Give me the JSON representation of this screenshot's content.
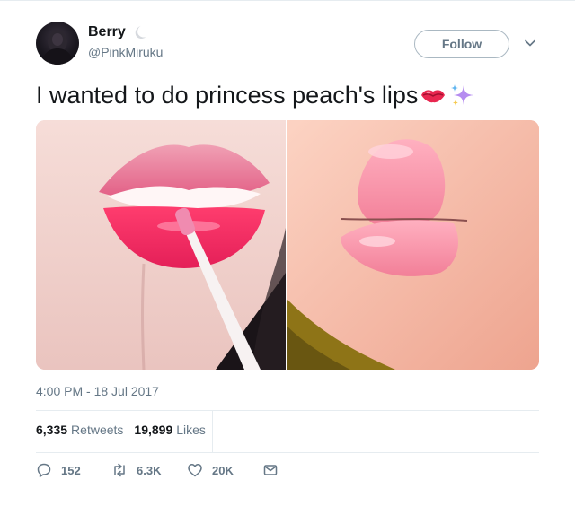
{
  "user": {
    "display_name": "Berry",
    "handle": "@PinkMiruku",
    "name_emoji": "crescent-moon-icon"
  },
  "follow_button": {
    "label": "Follow"
  },
  "tweet": {
    "text": "I wanted to do princess peach's lips",
    "emojis": [
      "kiss-mark-icon",
      "sparkles-icon"
    ],
    "timestamp": "4:00 PM - 18 Jul 2017"
  },
  "media": {
    "images": [
      "lips-with-gloss-photo",
      "princess-peach-lips-render"
    ]
  },
  "stats": {
    "retweets_count": "6,335",
    "retweets_label": "Retweets",
    "likes_count": "19,899",
    "likes_label": "Likes"
  },
  "actions": {
    "reply_count": "152",
    "retweet_count": "6.3K",
    "like_count": "20K"
  },
  "colors": {
    "text_primary": "#14171a",
    "text_secondary": "#657786",
    "border": "#e6ecf0"
  }
}
